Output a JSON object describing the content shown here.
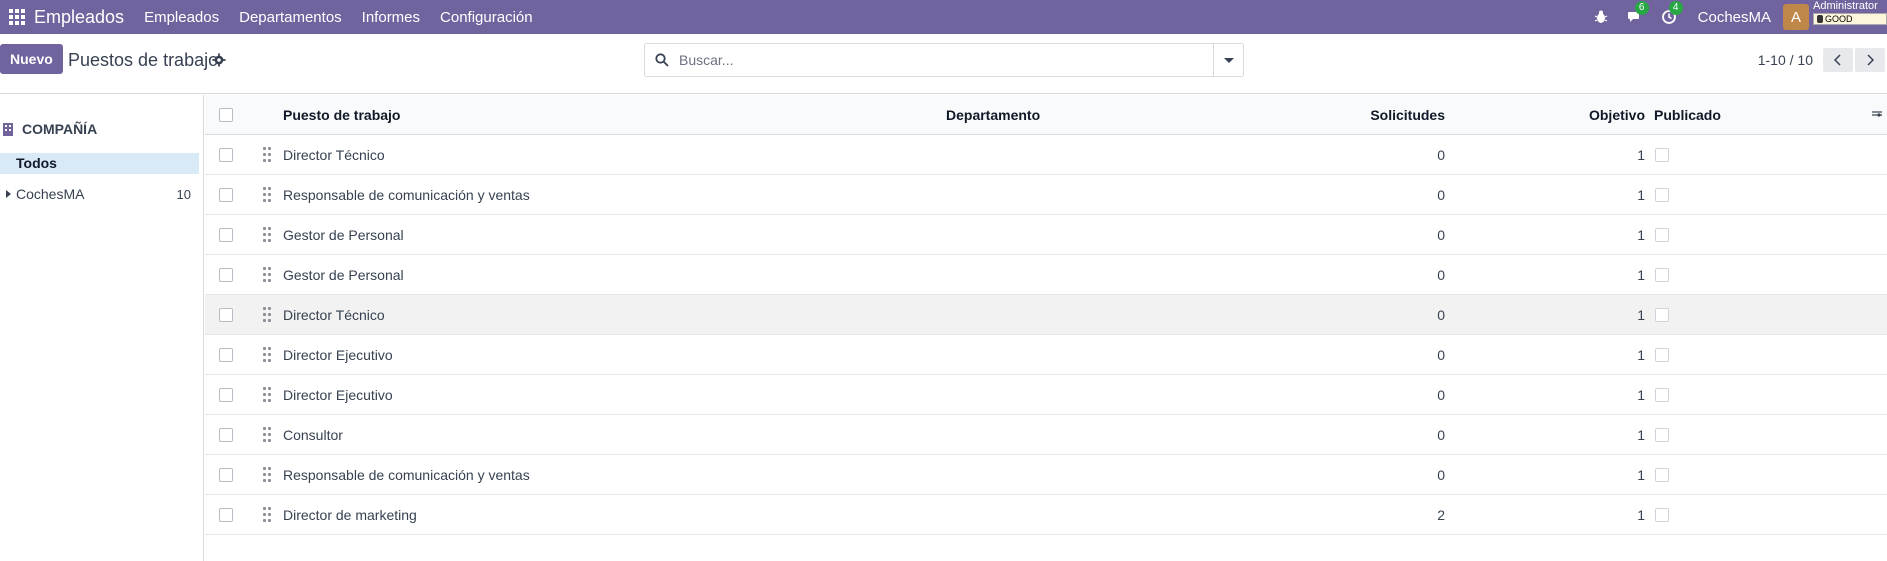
{
  "navbar": {
    "app_name": "Empleados",
    "menu": [
      "Empleados",
      "Departamentos",
      "Informes",
      "Configuración"
    ],
    "messages_badge": "6",
    "activities_badge": "4",
    "company": "CochesMA",
    "avatar_letter": "A",
    "user_name": "Administrator",
    "db_label": "GOOD"
  },
  "control": {
    "new_button": "Nuevo",
    "title": "Puestos de trabajo",
    "search_placeholder": "Buscar...",
    "pager": "1-10 / 10"
  },
  "sidebar": {
    "header": "COMPAÑÍA",
    "all_label": "Todos",
    "company_label": "CochesMA",
    "company_count": "10"
  },
  "table": {
    "headers": {
      "name": "Puesto de trabajo",
      "department": "Departamento",
      "applications": "Solicitudes",
      "target": "Objetivo",
      "published": "Publicado"
    },
    "rows": [
      {
        "name": "Director Técnico",
        "department": "",
        "applications": "0",
        "target": "1"
      },
      {
        "name": "Responsable de comunicación y ventas",
        "department": "",
        "applications": "0",
        "target": "1"
      },
      {
        "name": "Gestor de Personal",
        "department": "",
        "applications": "0",
        "target": "1"
      },
      {
        "name": "Gestor de Personal",
        "department": "",
        "applications": "0",
        "target": "1"
      },
      {
        "name": "Director Técnico",
        "department": "",
        "applications": "0",
        "target": "1"
      },
      {
        "name": "Director Ejecutivo",
        "department": "",
        "applications": "0",
        "target": "1"
      },
      {
        "name": "Director Ejecutivo",
        "department": "",
        "applications": "0",
        "target": "1"
      },
      {
        "name": "Consultor",
        "department": "",
        "applications": "0",
        "target": "1"
      },
      {
        "name": "Responsable de comunicación y ventas",
        "department": "",
        "applications": "0",
        "target": "1"
      },
      {
        "name": "Director de marketing",
        "department": "",
        "applications": "2",
        "target": "1"
      }
    ]
  },
  "colors": {
    "brand": "#71639e",
    "badge": "#28a745",
    "selected": "#d9eaf7"
  }
}
